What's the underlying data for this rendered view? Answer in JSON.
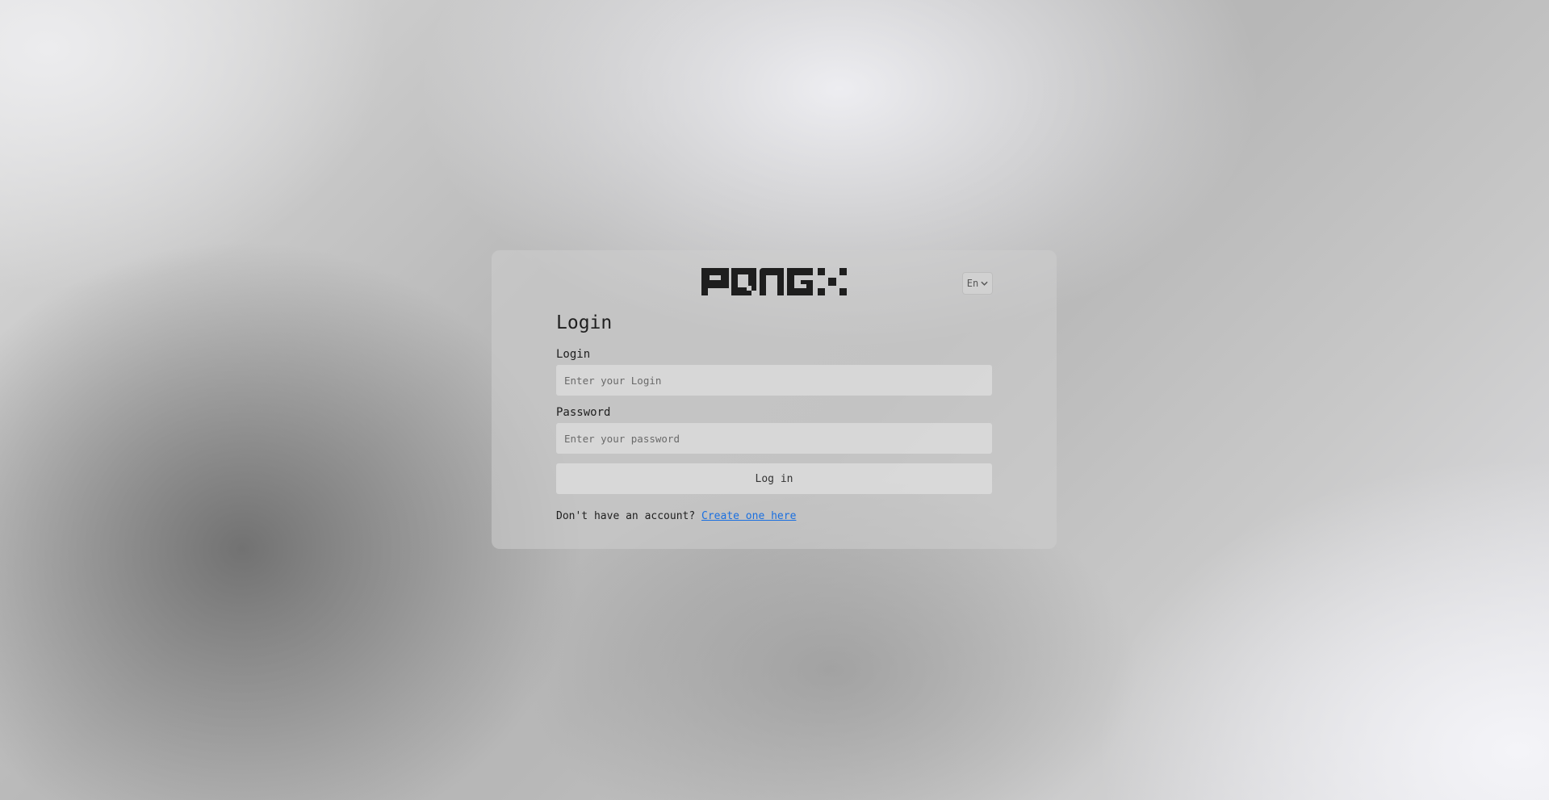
{
  "brand": {
    "logo_text": "PONGX",
    "logo_color": "#1e1e1e"
  },
  "language": {
    "selected": "En",
    "icon": "chevron-down-icon"
  },
  "login_form": {
    "title": "Login",
    "login_label": "Login",
    "login_placeholder": "Enter your Login",
    "password_label": "Password",
    "password_placeholder": "Enter your password",
    "submit_label": "Log in",
    "signup_prompt": "Don't have an account?",
    "signup_link": "Create one here",
    "link_color": "#1a6fe0"
  }
}
